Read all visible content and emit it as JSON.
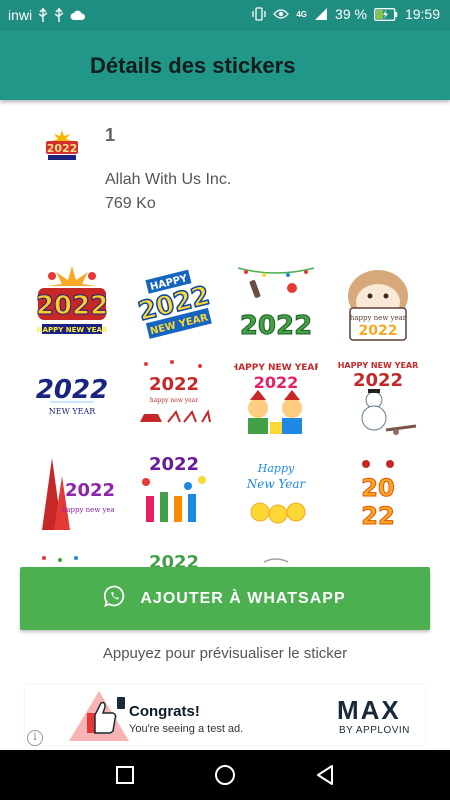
{
  "status_bar": {
    "carrier": "inwi",
    "network": "4G",
    "battery_percent": "39 %",
    "time": "19:59"
  },
  "app_bar": {
    "title": "Détails des stickers"
  },
  "pack": {
    "name": "1",
    "publisher": "Allah With Us Inc.",
    "size": "769 Ko"
  },
  "stickers": [
    {
      "icon": "happy-2022-fireworks-sticker"
    },
    {
      "icon": "happy-2022-new-year-blue-sticker"
    },
    {
      "icon": "2022-champagne-sticker"
    },
    {
      "icon": "hamster-happy-new-year-sticker"
    },
    {
      "icon": "2022-new-year-navy-sticker"
    },
    {
      "icon": "2022-reindeer-sleigh-sticker"
    },
    {
      "icon": "happy-new-year-kids-sticker"
    },
    {
      "icon": "happy-new-year-snowman-sticker"
    },
    {
      "icon": "2022-christmas-trees-sticker"
    },
    {
      "icon": "2022-party-people-sticker"
    },
    {
      "icon": "happy-new-year-emoji-sticker"
    },
    {
      "icon": "2022-gold-candy-sticker"
    },
    {
      "icon": "partial-sticker"
    },
    {
      "icon": "partial-2022-sticker"
    },
    {
      "icon": "partial-sticker"
    }
  ],
  "add_button": {
    "label": "AJOUTER À WHATSAPP",
    "color": "#4caf50"
  },
  "hint": "Appuyez pour prévisualiser le sticker",
  "ad": {
    "headline": "Congrats!",
    "subtext": "You're seeing a test ad.",
    "brand": "MAX",
    "brand_by": "BY APPLOVIN",
    "info_glyph": "i"
  },
  "colors": {
    "status_bar": "#1f8d80",
    "app_bar": "#21978a",
    "button": "#4caf50"
  }
}
